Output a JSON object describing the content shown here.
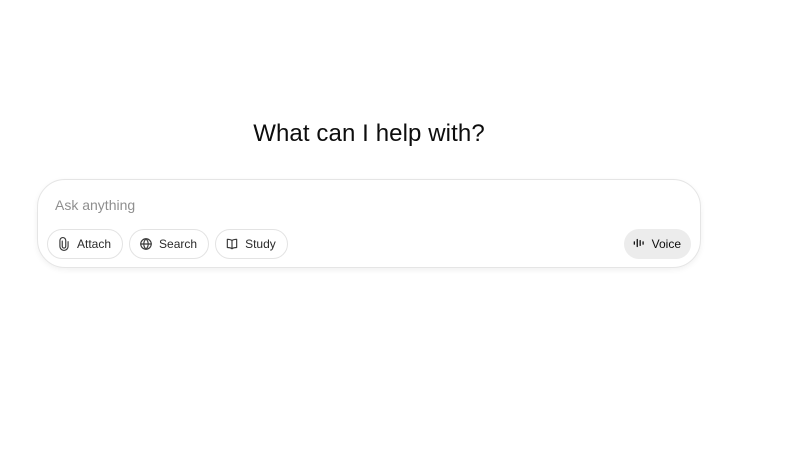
{
  "main": {
    "headline": "What can I help with?"
  },
  "composer": {
    "placeholder": "Ask anything",
    "value": "",
    "tools": [
      {
        "label": "Attach",
        "icon": "paperclip-icon"
      },
      {
        "label": "Search",
        "icon": "globe-icon"
      },
      {
        "label": "Study",
        "icon": "book-icon"
      }
    ],
    "voice": {
      "label": "Voice",
      "icon": "waveform-icon"
    }
  },
  "colors": {
    "background": "#ffffff",
    "text": "#0d0d0d",
    "placeholder": "#8f8f8f",
    "border": "#e5e5e5",
    "voice_bg": "#ececec"
  }
}
